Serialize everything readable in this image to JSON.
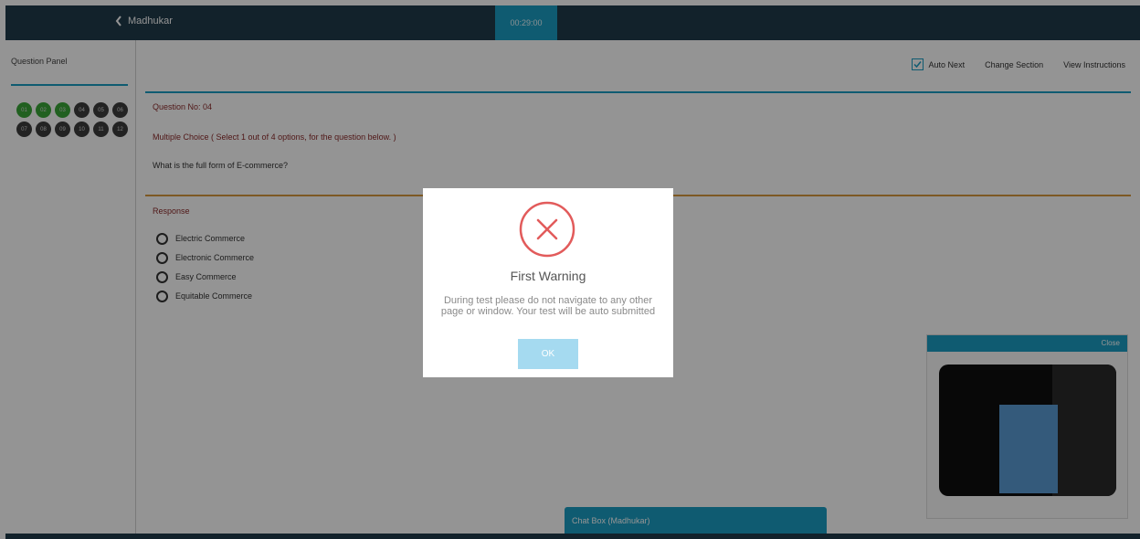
{
  "header": {
    "back_label": "Madhukar",
    "timer": "00:29:00"
  },
  "sidebar": {
    "title": "Question Panel",
    "questions": [
      {
        "num": "01",
        "status": "answered"
      },
      {
        "num": "02",
        "status": "answered"
      },
      {
        "num": "03",
        "status": "answered"
      },
      {
        "num": "04",
        "status": "not-answered"
      },
      {
        "num": "05",
        "status": "not-answered"
      },
      {
        "num": "06",
        "status": "not-answered"
      },
      {
        "num": "07",
        "status": "not-answered"
      },
      {
        "num": "08",
        "status": "not-answered"
      },
      {
        "num": "09",
        "status": "not-answered"
      },
      {
        "num": "10",
        "status": "not-answered"
      },
      {
        "num": "11",
        "status": "not-answered"
      },
      {
        "num": "12",
        "status": "not-answered"
      }
    ]
  },
  "toolbar": {
    "auto_next_label": "Auto Next",
    "auto_next_checked": true,
    "change_section_label": "Change Section",
    "view_instructions_label": "View Instructions"
  },
  "question": {
    "number_label": "Question No: 04",
    "type_label": "Multiple Choice ( Select 1 out of 4 options, for the question below. )",
    "text": "What is the full form of E-commerce?"
  },
  "response": {
    "label": "Response",
    "options": [
      "Electric Commerce",
      "Electronic Commerce",
      "Easy Commerce",
      "Equitable Commerce"
    ]
  },
  "dialog": {
    "title": "First Warning",
    "message": "During test please do not navigate to any other page or window. Your test will be auto submitted",
    "ok_label": "OK"
  },
  "camera": {
    "close_label": "Close"
  },
  "chat": {
    "label": "Chat Box (Madhukar)"
  },
  "colors": {
    "header": "#1f3b4b",
    "accent": "#1a9ec3",
    "answered": "#3aa537",
    "not_answered": "#3d3d3d",
    "warning": "#e25b5b"
  }
}
